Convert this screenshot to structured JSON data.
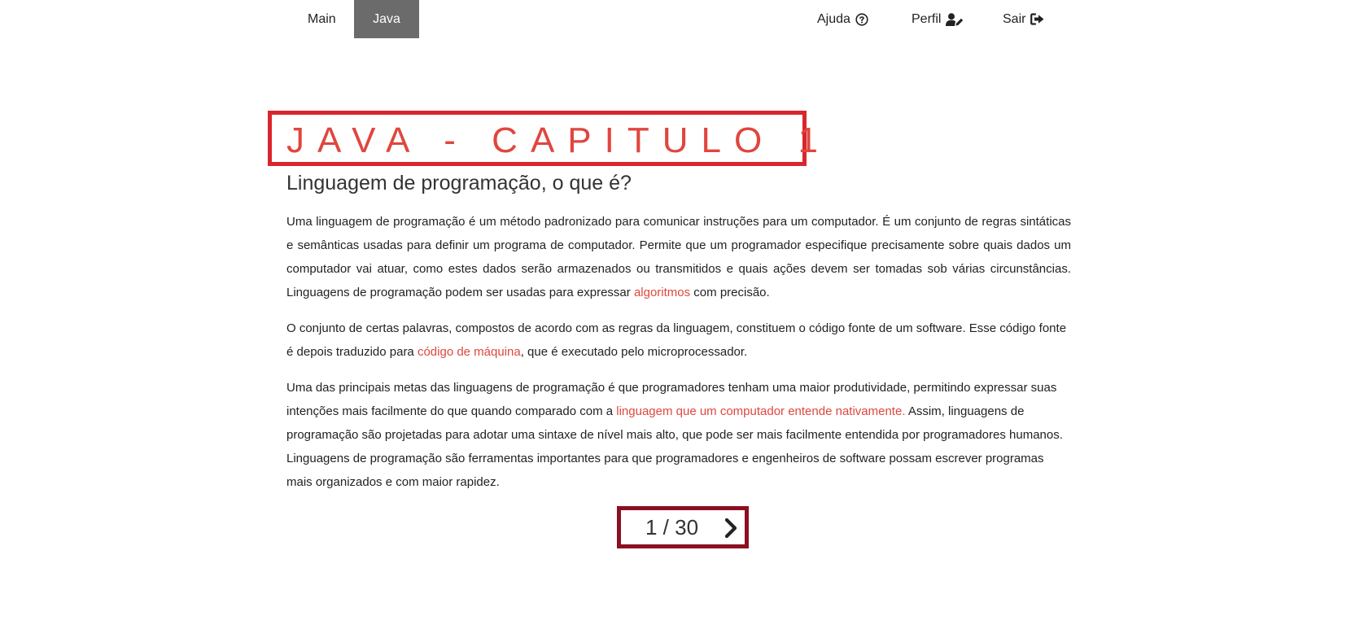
{
  "nav": {
    "left_items": [
      {
        "label": "Main"
      },
      {
        "label": "Java"
      }
    ],
    "ajuda_label": "Ajuda",
    "perfil_label": "Perfil",
    "sair_label": "Sair",
    "icons": {
      "ajuda": "question-circle-icon",
      "perfil": "user-edit-icon",
      "sair": "sign-out-icon"
    },
    "active_color": "#6b6b6b"
  },
  "main": {
    "title": "JAVA - CAPITULO 1",
    "subtitle": "Linguagem de programação, o que é?",
    "p1": {
      "text_before": "Uma linguagem de programação é um método padronizado para comunicar instruções para um computador. É um conjunto de regras sintáticas e semânticas usadas para definir um programa de computador. Permite que um programador especifique precisamente sobre quais dados um computador vai atuar, como estes dados serão armazenados ou transmitidos e quais ações devem ser tomadas sob várias circunstâncias. Linguagens de programação podem ser usadas para expressar ",
      "link": "algoritmos",
      "text_after": " com precisão."
    },
    "p2": {
      "text_before": "O conjunto de certas palavras, compostos de acordo com as regras da linguagem, constituem o código fonte de um software. Esse código fonte é depois traduzido para ",
      "link": "código de máquina",
      "text_after": ", que é executado pelo microprocessador."
    },
    "p3": {
      "text_before": "Uma das principais metas das linguagens de programação é que programadores tenham uma maior produtividade, permitindo expressar suas intenções mais facilmente do que quando comparado com a ",
      "link": "linguagem que um computador entende nativamente.",
      "text_after": " Assim, linguagens de programação são projetadas para adotar uma sintaxe de nível mais alto, que pode ser mais facilmente entendida por programadores humanos. Linguagens de programação são ferramentas importantes para que programadores e engenheiros de software possam escrever programas mais organizados e com maior rapidez."
    }
  },
  "pagination": {
    "current": 1,
    "total": 30,
    "label": "1 / 30",
    "next_icon": "chevron-right-icon"
  },
  "colors": {
    "accent": "#e0463e",
    "title_box_border": "#d9262e",
    "pager_box_border": "#8b1020"
  }
}
